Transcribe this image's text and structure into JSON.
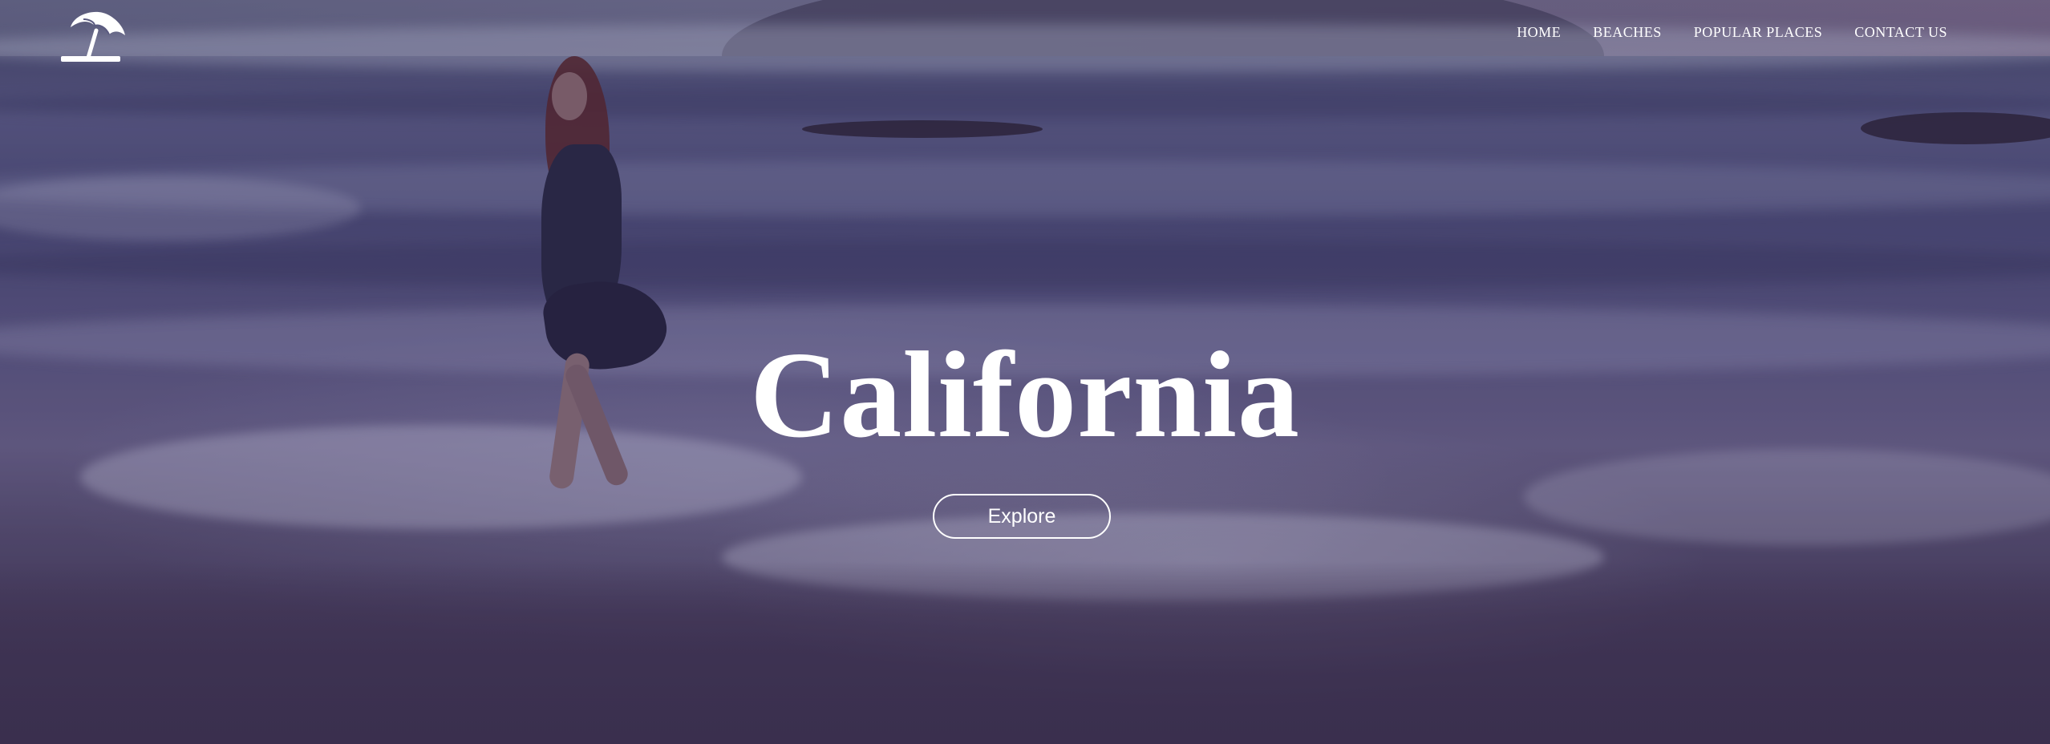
{
  "nav": {
    "items": [
      {
        "label": "HOME"
      },
      {
        "label": "BEACHES"
      },
      {
        "label": "POPULAR PLACES"
      },
      {
        "label": "CONTACT US"
      }
    ]
  },
  "hero": {
    "title": "California",
    "cta_label": "Explore",
    "background_image": "woman running along the beach into ocean waves at dusk"
  },
  "logo": {
    "icon": "beach-umbrella-icon"
  },
  "colors": {
    "text": "#ffffff",
    "overlay_tint": "#4b4470"
  }
}
